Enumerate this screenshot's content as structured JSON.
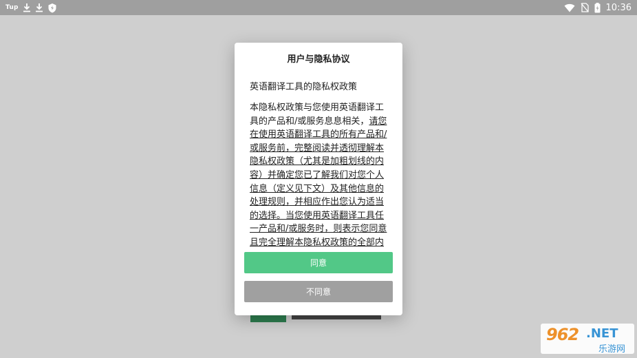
{
  "statusbar": {
    "app_name": "Tup",
    "time": "10:36"
  },
  "dialog": {
    "title": "用户与隐私协议",
    "heading": "英语翻译工具的隐私权政策",
    "body_intro": "本隐私权政策与您使用英语翻译工具的产品和/或服务息息相关，",
    "body_underlined": "请您在使用英语翻译工具的所有产品和/或服务前，完整阅读并透彻理解本隐私权政策（尤其是加粗划线的内容）并确定您已了解我们对您个人信息（定义见下文）及其他信息的处理规则，并相应作出您认为适当的选择。当您使用英语翻译工具任一产品和/或服务时，则表示您同意且完全理解本隐私权政策的全部内容。",
    "agree_label": "同意",
    "disagree_label": "不同意"
  },
  "watermark": {
    "brand": "962",
    "tld": ".NET",
    "cn": "乐游网"
  },
  "colors": {
    "overlay_bg": "#cfcfcf",
    "statusbar_bg": "#9f9f9f",
    "agree": "#52c887",
    "disagree": "#a0a0a0"
  },
  "icons": [
    "download-icon",
    "download-icon",
    "shield-icon",
    "wifi-icon",
    "no-sim-icon",
    "battery-icon"
  ]
}
